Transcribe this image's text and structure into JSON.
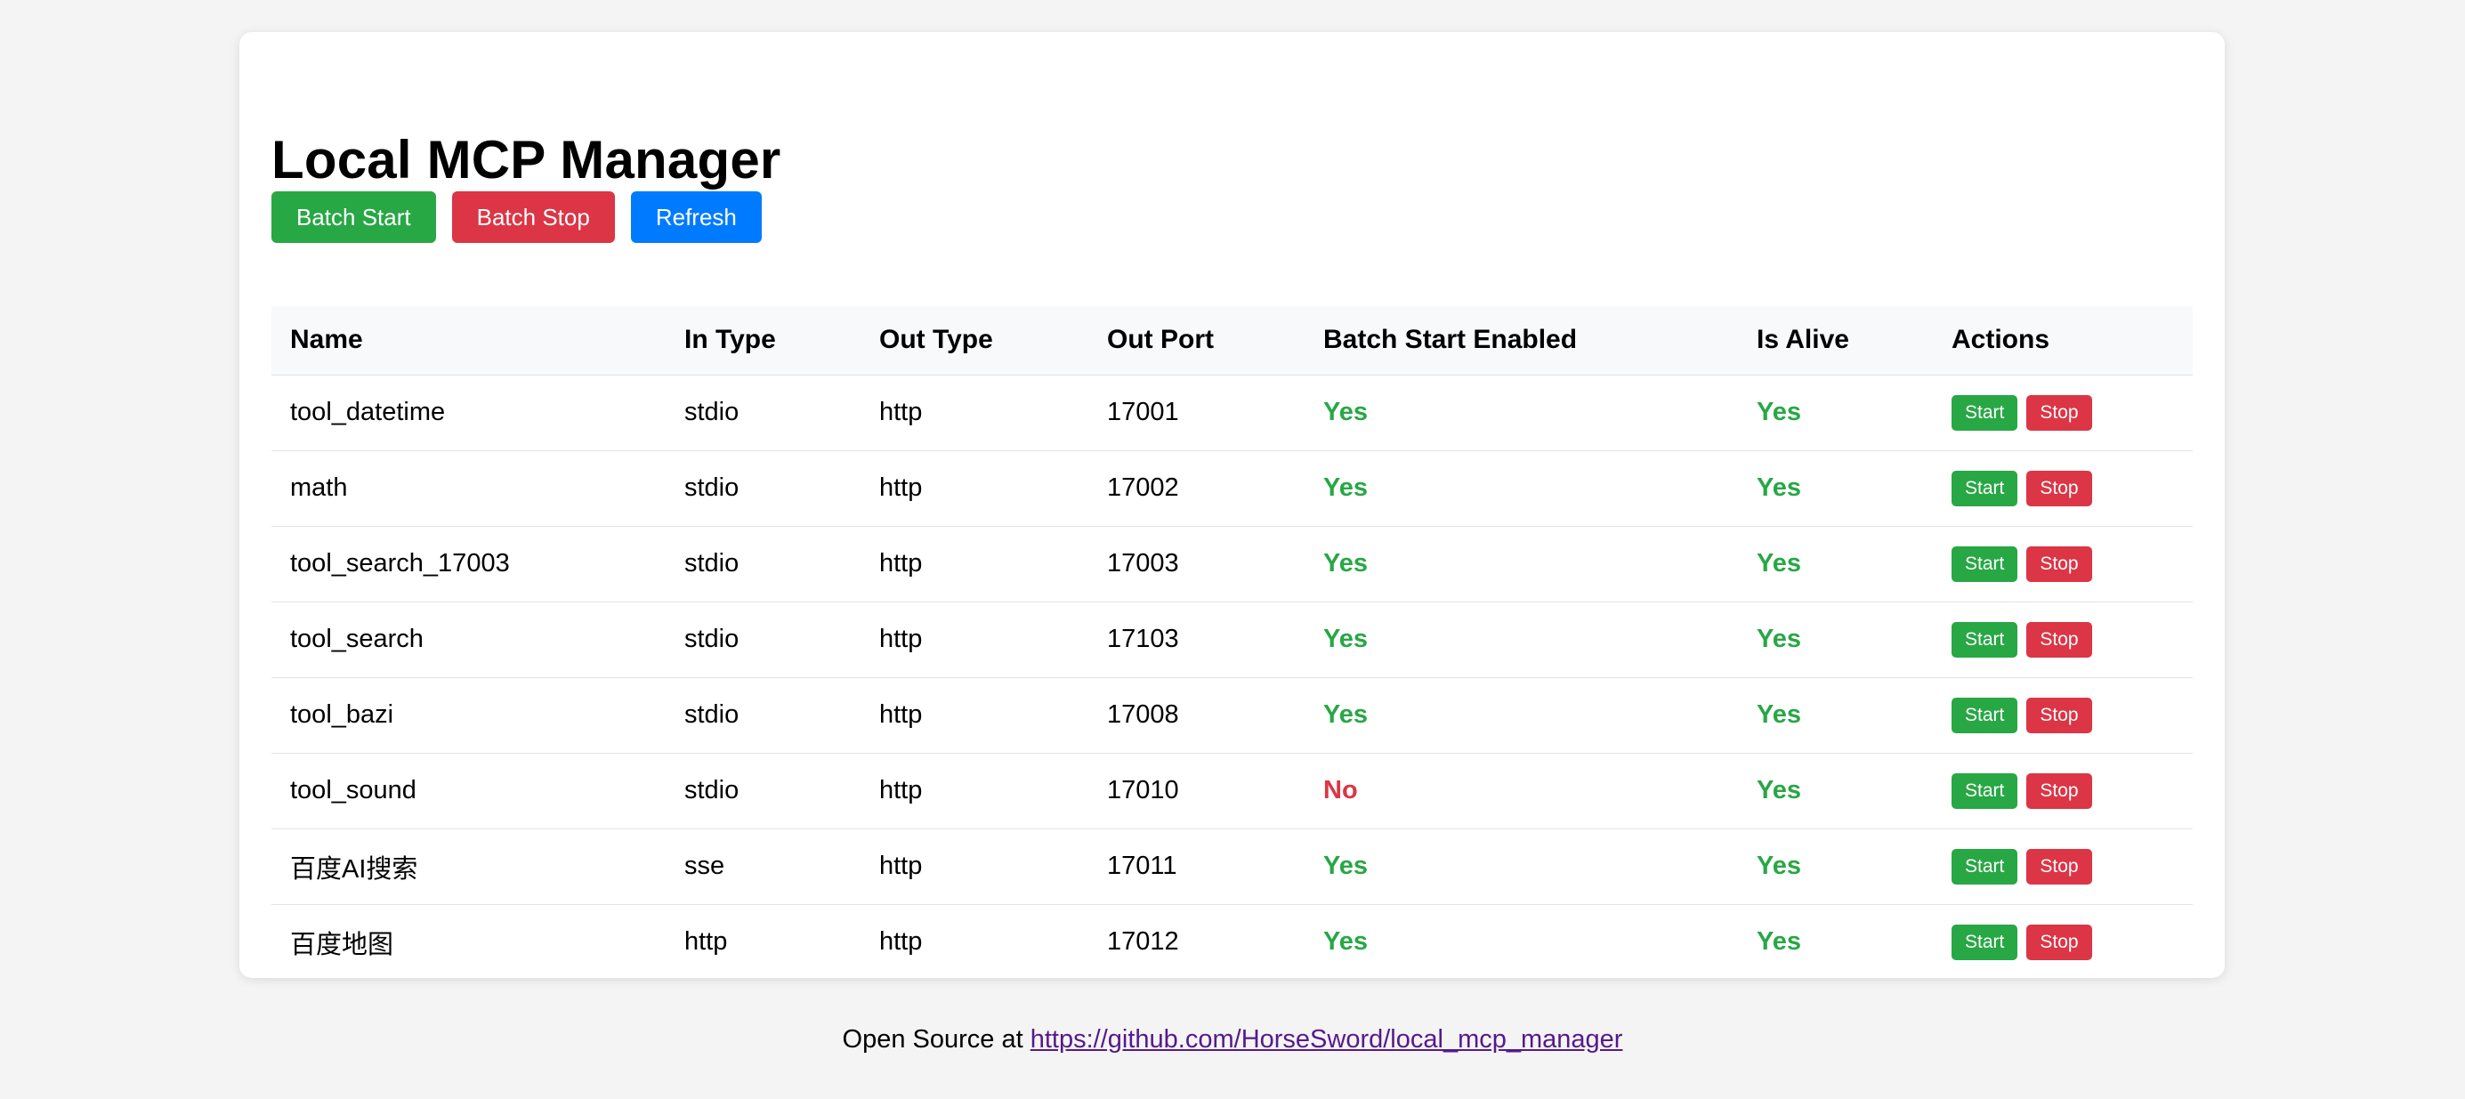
{
  "page": {
    "title": "Local MCP Manager"
  },
  "toolbar": {
    "batch_start_label": "Batch Start",
    "batch_stop_label": "Batch Stop",
    "refresh_label": "Refresh"
  },
  "table": {
    "headers": [
      "Name",
      "In Type",
      "Out Type",
      "Out Port",
      "Batch Start Enabled",
      "Is Alive",
      "Actions"
    ],
    "rows": [
      {
        "name": "tool_datetime",
        "in_type": "stdio",
        "out_type": "http",
        "out_port": "17001",
        "batch_start": "Yes",
        "alive": "Yes",
        "start_label": "Start",
        "stop_label": "Stop"
      },
      {
        "name": "math",
        "in_type": "stdio",
        "out_type": "http",
        "out_port": "17002",
        "batch_start": "Yes",
        "alive": "Yes",
        "start_label": "Start",
        "stop_label": "Stop"
      },
      {
        "name": "tool_search_17003",
        "in_type": "stdio",
        "out_type": "http",
        "out_port": "17003",
        "batch_start": "Yes",
        "alive": "Yes",
        "start_label": "Start",
        "stop_label": "Stop"
      },
      {
        "name": "tool_search",
        "in_type": "stdio",
        "out_type": "http",
        "out_port": "17103",
        "batch_start": "Yes",
        "alive": "Yes",
        "start_label": "Start",
        "stop_label": "Stop"
      },
      {
        "name": "tool_bazi",
        "in_type": "stdio",
        "out_type": "http",
        "out_port": "17008",
        "batch_start": "Yes",
        "alive": "Yes",
        "start_label": "Start",
        "stop_label": "Stop"
      },
      {
        "name": "tool_sound",
        "in_type": "stdio",
        "out_type": "http",
        "out_port": "17010",
        "batch_start": "No",
        "alive": "Yes",
        "start_label": "Start",
        "stop_label": "Stop"
      },
      {
        "name": "百度AI搜索",
        "in_type": "sse",
        "out_type": "http",
        "out_port": "17011",
        "batch_start": "Yes",
        "alive": "Yes",
        "start_label": "Start",
        "stop_label": "Stop"
      },
      {
        "name": "百度地图",
        "in_type": "http",
        "out_type": "http",
        "out_port": "17012",
        "batch_start": "Yes",
        "alive": "Yes",
        "start_label": "Start",
        "stop_label": "Stop"
      }
    ]
  },
  "footer": {
    "prefix": "Open Source at ",
    "link_text": "https://github.com/HorseSword/local_mcp_manager",
    "link_href": "https://github.com/HorseSword/local_mcp_manager"
  },
  "colors": {
    "green": "#28a745",
    "red": "#dc3545",
    "blue": "#007bff",
    "background": "#f4f4f4",
    "card": "#ffffff"
  }
}
